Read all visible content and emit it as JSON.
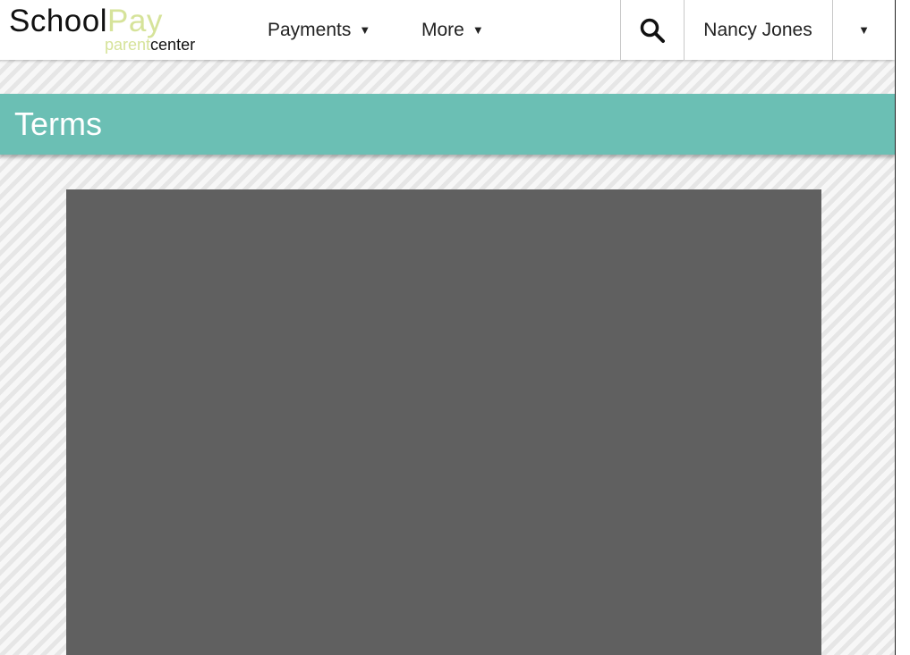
{
  "brand": {
    "logo_school": "School",
    "logo_pay": "Pay",
    "logo_parent": "parent",
    "logo_center": "center",
    "accent_color": "#d6e39a"
  },
  "nav": {
    "items": [
      {
        "label": "Payments",
        "icon": "caret-down-icon"
      },
      {
        "label": "More",
        "icon": "caret-down-icon"
      }
    ],
    "search_icon": "search-icon"
  },
  "user": {
    "name": "Nancy Jones",
    "menu_icon": "caret-down-icon"
  },
  "page": {
    "title": "Terms",
    "banner_color": "#6bbfb4",
    "content_panel_color": "#606060"
  }
}
